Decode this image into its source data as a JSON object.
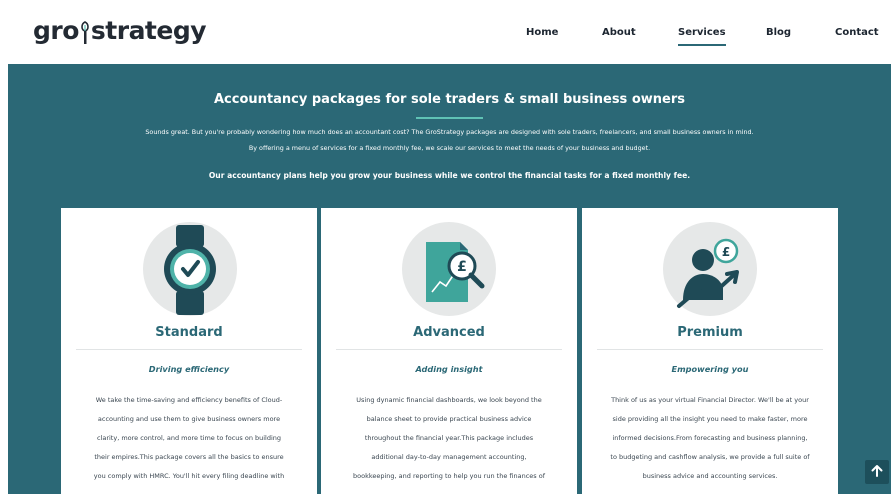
{
  "header": {
    "logo": {
      "part1": "gro",
      "part2": "strategy"
    },
    "nav": [
      {
        "label": "Home",
        "active": false
      },
      {
        "label": "About",
        "active": false
      },
      {
        "label": "Services",
        "active": true
      },
      {
        "label": "Blog",
        "active": false
      },
      {
        "label": "Contact",
        "active": false
      }
    ]
  },
  "hero": {
    "title": "Accountancy packages for sole traders & small business owners",
    "paragraph_line1": "Sounds great. But you're probably wondering how much does an accountant cost? The GroStrategy packages are designed with sole traders, freelancers, and small business owners in mind.",
    "paragraph_line2": "By offering a menu of services for a fixed monthly fee, we scale our services to meet the needs of your business and budget.",
    "strong": "Our accountancy plans help you grow your business while we control the financial tasks for a fixed monthly fee."
  },
  "cards": [
    {
      "title": "Standard",
      "subtitle": "Driving efficiency",
      "icon": "watch-check-icon",
      "lines": [
        "We take the time-saving and efficiency benefits of Cloud-",
        "accounting and use them to give business owners more",
        "clarity, more control, and more time to focus on building",
        "their empires.This package covers all the basics to ensure",
        "you comply with HMRC. You'll hit every filing deadline with"
      ]
    },
    {
      "title": "Advanced",
      "subtitle": "Adding insight",
      "icon": "report-magnifier-icon",
      "lines": [
        "Using dynamic financial dashboards, we look beyond the",
        "balance sheet to provide practical business advice",
        "throughout the financial year.This package includes",
        "additional day-to-day management accounting,",
        "bookkeeping, and reporting to help you run the finances of"
      ]
    },
    {
      "title": "Premium",
      "subtitle": "Empowering you",
      "icon": "person-growth-icon",
      "lines": [
        "Think of us as your virtual Financial Director. We'll be at your",
        "side providing all the insight you need to make faster, more",
        "informed decisions.From forecasting and business planning,",
        "to budgeting and cashflow analysis, we provide a full suite of",
        "business advice and accounting services."
      ]
    }
  ],
  "colors": {
    "teal": "#2b6876",
    "mint": "#5fc2b5",
    "dark": "#232a33"
  }
}
